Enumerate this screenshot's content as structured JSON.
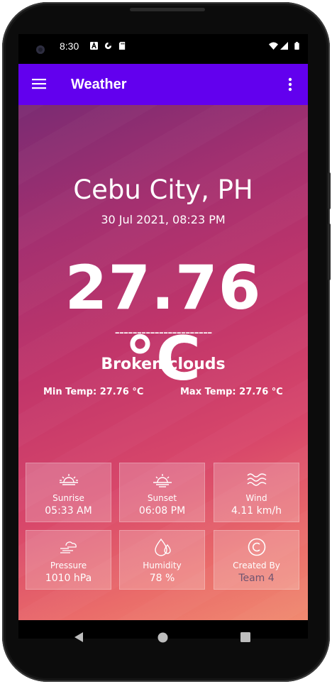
{
  "status_bar": {
    "time": "8:30",
    "icons": [
      "a-icon",
      "data-saver-icon",
      "sd-card-icon",
      "wifi-icon",
      "signal-icon",
      "battery-icon"
    ]
  },
  "app_bar": {
    "title": "Weather",
    "menu_icon": "menu-icon",
    "more_icon": "more-vert-icon",
    "color": "#6200ee"
  },
  "weather": {
    "location": "Cebu City, PH",
    "datetime": "30 Jul 2021, 08:23 PM",
    "temperature": "27.76 °C",
    "divider": "----------------------",
    "description": "Broken clouds",
    "min_temp": "Min Temp: 27.76 °C",
    "max_temp": "Max Temp: 27.76 °C"
  },
  "cards": [
    {
      "icon": "sunrise-icon",
      "label": "Sunrise",
      "value": "05:33 AM"
    },
    {
      "icon": "sunset-icon",
      "label": "Sunset",
      "value": "06:08 PM"
    },
    {
      "icon": "wind-icon",
      "label": "Wind",
      "value": "4.11 km/h"
    },
    {
      "icon": "pressure-icon",
      "label": "Pressure",
      "value": "1010 hPa"
    },
    {
      "icon": "humidity-icon",
      "label": "Humidity",
      "value": "78 %"
    },
    {
      "icon": "copyright-icon",
      "label": "Created By",
      "value": "Team 4"
    }
  ],
  "nav_bar": {
    "icons": [
      "back-icon",
      "home-icon",
      "recents-icon"
    ]
  }
}
